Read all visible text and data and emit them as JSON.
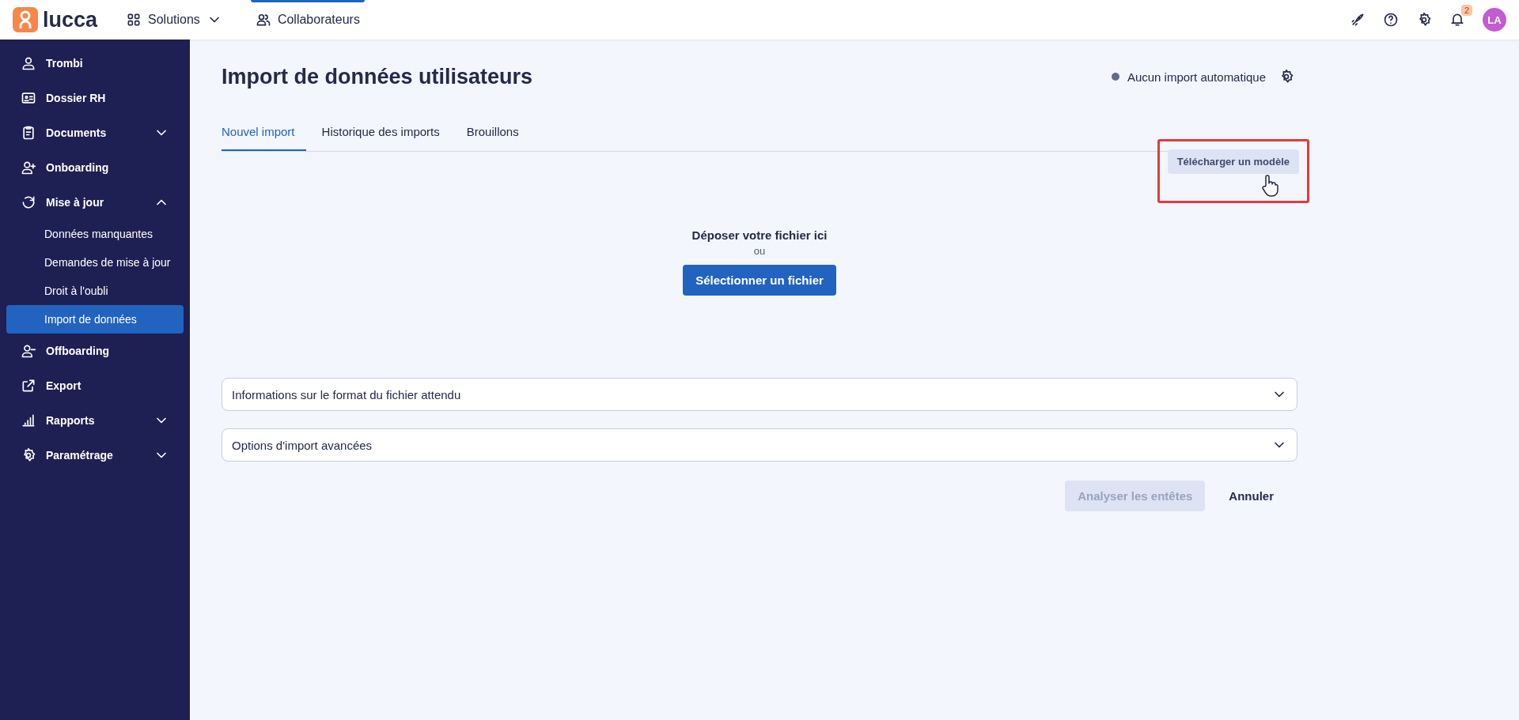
{
  "topbar": {
    "logo": "lucca",
    "nav": [
      {
        "label": "Solutions",
        "selected": false,
        "dropdown": true
      },
      {
        "label": "Collaborateurs",
        "selected": true
      }
    ],
    "notifications": "2",
    "avatar": "LA"
  },
  "sidebar": {
    "items": [
      {
        "label": "Trombi",
        "selected": false
      },
      {
        "label": "Dossier RH",
        "selected": false
      },
      {
        "label": "Documents",
        "selected": false,
        "expanded": false
      },
      {
        "label": "Onboarding",
        "selected": false
      },
      {
        "label": "Mise à jour",
        "selected": false,
        "expanded": true,
        "children": [
          {
            "label": "Données manquantes",
            "selected": false
          },
          {
            "label": "Demandes de mise à jour",
            "selected": false
          },
          {
            "label": "Droit à l'oubli",
            "selected": false
          },
          {
            "label": "Import de données",
            "selected": true
          }
        ]
      },
      {
        "label": "Offboarding",
        "selected": false
      },
      {
        "label": "Export",
        "selected": false
      },
      {
        "label": "Rapports",
        "selected": false,
        "expanded": false
      },
      {
        "label": "Paramétrage",
        "selected": false,
        "expanded": false
      }
    ]
  },
  "page": {
    "title": "Import de données utilisateurs",
    "auto_import": "Aucun import automatique",
    "tabs": [
      {
        "label": "Nouvel import",
        "selected": true
      },
      {
        "label": "Historique des imports",
        "selected": false
      },
      {
        "label": "Brouillons",
        "selected": false
      }
    ],
    "template_button": {
      "label": "Télécharger un modèle",
      "highlighted": true
    },
    "dropzone": {
      "text": "Déposer votre fichier ici",
      "or": "ou",
      "button": "Sélectionner un fichier"
    },
    "accordions": [
      {
        "label": "Informations sur le format du fichier attendu",
        "expanded": false
      },
      {
        "label": "Options d'import avancées",
        "expanded": false
      }
    ],
    "actions": [
      {
        "label": "Analyser les entêtes",
        "kind": "primary",
        "disabled": true
      },
      {
        "label": "Annuler",
        "kind": "text",
        "disabled": false
      }
    ]
  }
}
